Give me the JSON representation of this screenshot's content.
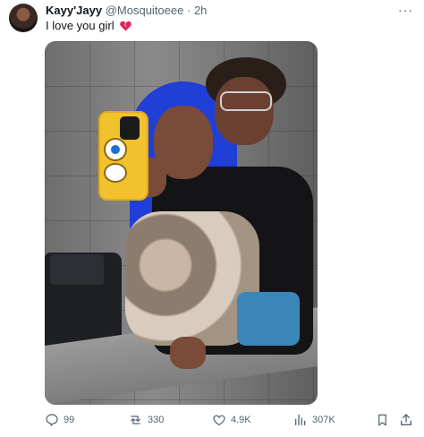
{
  "tweet": {
    "author_name": "Kayy'Jayy",
    "handle": "@Mosquitoeee",
    "separator": "·",
    "time": "2h",
    "more": "···",
    "text": "I love you girl",
    "emoji": "broken-heart-icon"
  },
  "actions": {
    "replies": "99",
    "retweets": "330",
    "likes": "4.9K",
    "views": "307K"
  }
}
